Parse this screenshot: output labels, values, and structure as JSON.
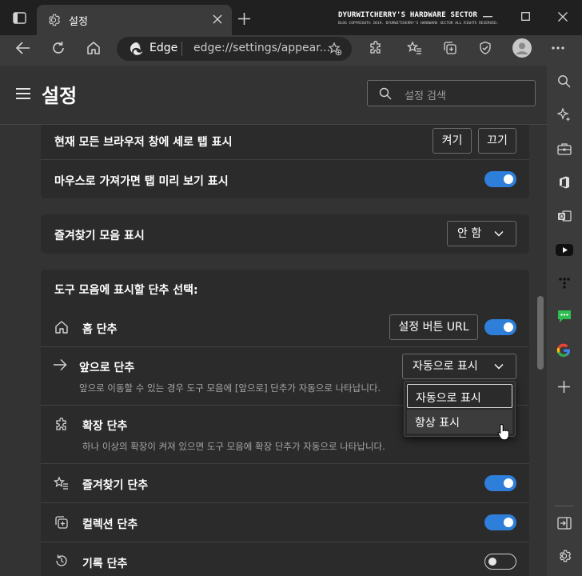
{
  "window": {
    "tab_title": "설정",
    "watermark_title": "DYURWITCHERRY'S HARDWARE SECTOR",
    "watermark_sub": "BLOG COPYRIGHT© 2019. DYURWITCHERRY'S HARDWARE SECTOR ALL RIGHTS RESERVED."
  },
  "toolbar": {
    "edge_label": "Edge",
    "url": "edge://settings/appear..."
  },
  "settings": {
    "title": "설정",
    "search_placeholder": "설정 검색"
  },
  "vertical_tabs": {
    "label": "현재 모든 브라우저 창에 세로 탭 표시",
    "on_button": "켜기",
    "off_button": "끄기"
  },
  "tab_preview": {
    "label": "마우스로 가져가면 탭 미리 보기 표시",
    "enabled": true
  },
  "favorites_bar": {
    "label": "즐겨찾기 모음 표시",
    "value": "안 함"
  },
  "toolbar_buttons": {
    "heading": "도구 모음에 표시할 단추 선택:",
    "home": {
      "label": "홈 단추",
      "url_button": "설정 버튼 URL",
      "enabled": true
    },
    "forward": {
      "label": "앞으로 단추",
      "value": "자동으로 표시",
      "desc": "앞으로 이동할 수 있는 경우 도구 모음에 [앞으로] 단추가 자동으로 나타납니다."
    },
    "extensions": {
      "label": "확장 단추",
      "desc": "하나 이상의 확장이 켜져 있으면 도구 모음에 확장 단추가 자동으로 나타납니다."
    },
    "favorites": {
      "label": "즐겨찾기 단추",
      "enabled": true
    },
    "collections": {
      "label": "컬렉션 단추",
      "enabled": true
    },
    "history": {
      "label": "기록 단추",
      "enabled": false
    }
  },
  "dropdown": {
    "options": [
      "자동으로 표시",
      "항상 표시"
    ],
    "selected_index": 0
  },
  "colors": {
    "accent": "#2e7fd9",
    "background": "#202020",
    "card": "#2b2b2b",
    "panel": "#333333"
  }
}
